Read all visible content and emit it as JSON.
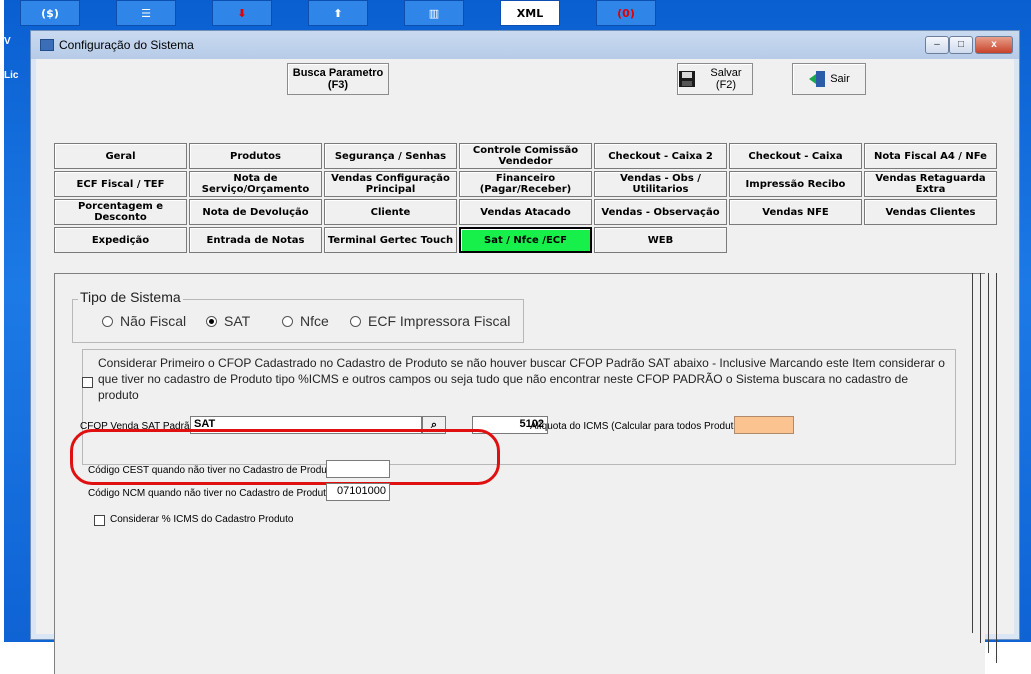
{
  "desktop": {
    "taskbar_icons": [
      {
        "label": "($)",
        "icon": "money-icon"
      },
      {
        "label": "",
        "icon": "document-icon"
      },
      {
        "label": "",
        "icon": "download-icon"
      },
      {
        "label": "",
        "icon": "upload-icon"
      },
      {
        "label": "",
        "icon": "chart-icon"
      },
      {
        "label": "XML",
        "icon": "xml-icon"
      },
      {
        "label": "(0)",
        "icon": "stop-icon"
      }
    ],
    "side_text_1": "V",
    "side_text_2": "Lic"
  },
  "window": {
    "title": "Configuração do Sistema",
    "minimize": "–",
    "maximize": "□",
    "close": "x"
  },
  "toolbar": {
    "search_label": "Busca Parametro (F3)",
    "save_label": "Salvar (F2)",
    "exit_label": "Sair"
  },
  "tabs": [
    [
      "Geral",
      "Produtos",
      "Segurança / Senhas",
      "Controle Comissão Vendedor",
      "Checkout - Caixa 2",
      "Checkout - Caixa",
      "Nota Fiscal A4 / NFe"
    ],
    [
      "ECF Fiscal / TEF",
      "Nota de Serviço/Orçamento",
      "Vendas Configuração Principal",
      "Financeiro (Pagar/Receber)",
      "Vendas - Obs / Utilitarios",
      "Impressão Recibo",
      "Vendas Retaguarda Extra"
    ],
    [
      "Porcentagem e Desconto",
      "Nota de Devolução",
      "Cliente",
      "Vendas Atacado",
      "Vendas - Observação",
      "Vendas NFE",
      "Vendas Clientes"
    ],
    [
      "Expedição",
      "Entrada de Notas",
      "Terminal Gertec Touch",
      "Sat / Nfce /ECF",
      "WEB"
    ]
  ],
  "active_tab": "Sat / Nfce /ECF",
  "system_type": {
    "legend": "Tipo de Sistema",
    "options": [
      "Não Fiscal",
      "SAT",
      "Nfce",
      "ECF Impressora Fiscal"
    ],
    "selected": "SAT"
  },
  "cfop_note": "Considerar Primeiro  o CFOP Cadastrado no Cadastro de Produto se não houver buscar CFOP Padrão SAT abaixo - Inclusive Marcando este Item considerar o que tiver no cadastro de Produto tipo %ICMS e outros campos ou seja tudo que não encontrar neste CFOP PADRÃO o Sistema buscara no cadastro de produto",
  "cfop_note_checked": false,
  "cfop": {
    "label": "CFOP Venda SAT Padrão",
    "value": "SAT",
    "code": "5102",
    "aliquota_label": "Alíquota do ICMS (Calcular para todos Produtos)",
    "aliquota_value": ""
  },
  "cest": {
    "label": "Código CEST quando não tiver no Cadastro de Produtos",
    "value": ""
  },
  "ncm": {
    "label": "Código NCM quando não tiver no Cadastro de Produtos",
    "value": "07101000"
  },
  "icms_check": {
    "label": "Considerar % ICMS do Cadastro Produto",
    "checked": false
  },
  "colors": {
    "active_tab": "#17f04a",
    "highlight_oval": "#e01010",
    "aliquota_field": "#fbc38f"
  }
}
